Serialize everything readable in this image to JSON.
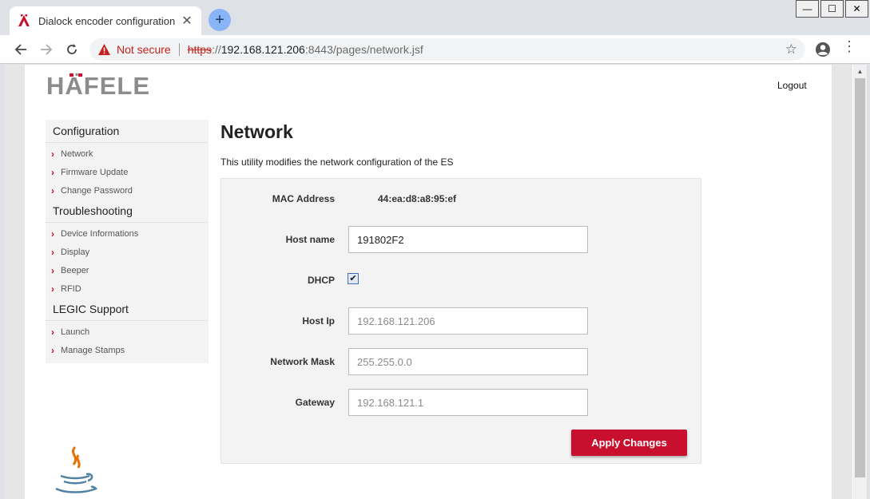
{
  "browser": {
    "tab_title": "Dialock encoder configuration",
    "tab_close": "✕",
    "new_tab": "+",
    "window_controls": [
      "—",
      "☐",
      "✕"
    ],
    "security_label": "Not secure",
    "url_scheme": "https",
    "url_sep": "://",
    "url_host": "192.168.121.206",
    "url_rest": ":8443/pages/network.jsf"
  },
  "header": {
    "logo_text": "HÄFELE",
    "logout_label": "Logout"
  },
  "sidebar": {
    "sections": [
      {
        "title": "Configuration",
        "items": [
          "Network",
          "Firmware Update",
          "Change Password"
        ]
      },
      {
        "title": "Troubleshooting",
        "items": [
          "Device Informations",
          "Display",
          "Beeper",
          "RFID"
        ]
      },
      {
        "title": "LEGIC Support",
        "items": [
          "Launch",
          "Manage Stamps"
        ]
      }
    ]
  },
  "main": {
    "title": "Network",
    "description": "This utility modifies the network configuration of the ES",
    "form": {
      "mac_label": "MAC Address",
      "mac_value": "44:ea:d8:a8:95:ef",
      "hostname_label": "Host name",
      "hostname_value": "191802F2",
      "dhcp_label": "DHCP",
      "dhcp_checked": true,
      "hostip_label": "Host Ip",
      "hostip_value": "192.168.121.206",
      "netmask_label": "Network Mask",
      "netmask_value": "255.255.0.0",
      "gateway_label": "Gateway",
      "gateway_value": "192.168.121.1",
      "apply_label": "Apply Changes"
    }
  },
  "colors": {
    "brand_red": "#c8102e",
    "logo_gray": "#8c8c8c"
  }
}
